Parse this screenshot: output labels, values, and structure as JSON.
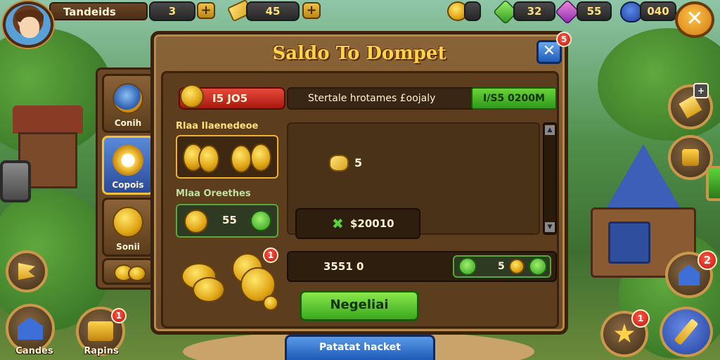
{
  "top_bar": {
    "player_name": "Tandeids",
    "res1_value": "3",
    "res2_value": "45",
    "res3_value": "",
    "gem_green_value": "32",
    "gem_purple_value": "55",
    "pot_value": "040",
    "plus_label": "+",
    "close_label": "✕"
  },
  "left_tabs": [
    {
      "label": "Conih"
    },
    {
      "label": "Copois"
    },
    {
      "label": "Sonii"
    }
  ],
  "left_side": {
    "cards_label": "Candes",
    "apps_label": "Rapins",
    "apps_badge": "1"
  },
  "right_side": {
    "top_badge_plus": "+",
    "house_badge": "2",
    "star_badge": "1"
  },
  "modal": {
    "title": "Saldo To Dompet",
    "close_label": "✕",
    "close_badge": "5",
    "balance": "I5 JO5",
    "transfer_label": "Stertale hrotames £oojaly",
    "transfer_value": "I/S5 0200M",
    "section1_label": "Rlaa Ilaenedeoe",
    "section2_label": "Mlaa Oreethes",
    "section2_value": "55",
    "nugget_value": "5",
    "amount_value": "$20010",
    "bottom_value": "3551 0",
    "bottom_green_value": "5",
    "stack_badge": "1",
    "confirm_label": "Negeliai"
  },
  "bottom_tab": {
    "label": "Patatat hacket"
  }
}
